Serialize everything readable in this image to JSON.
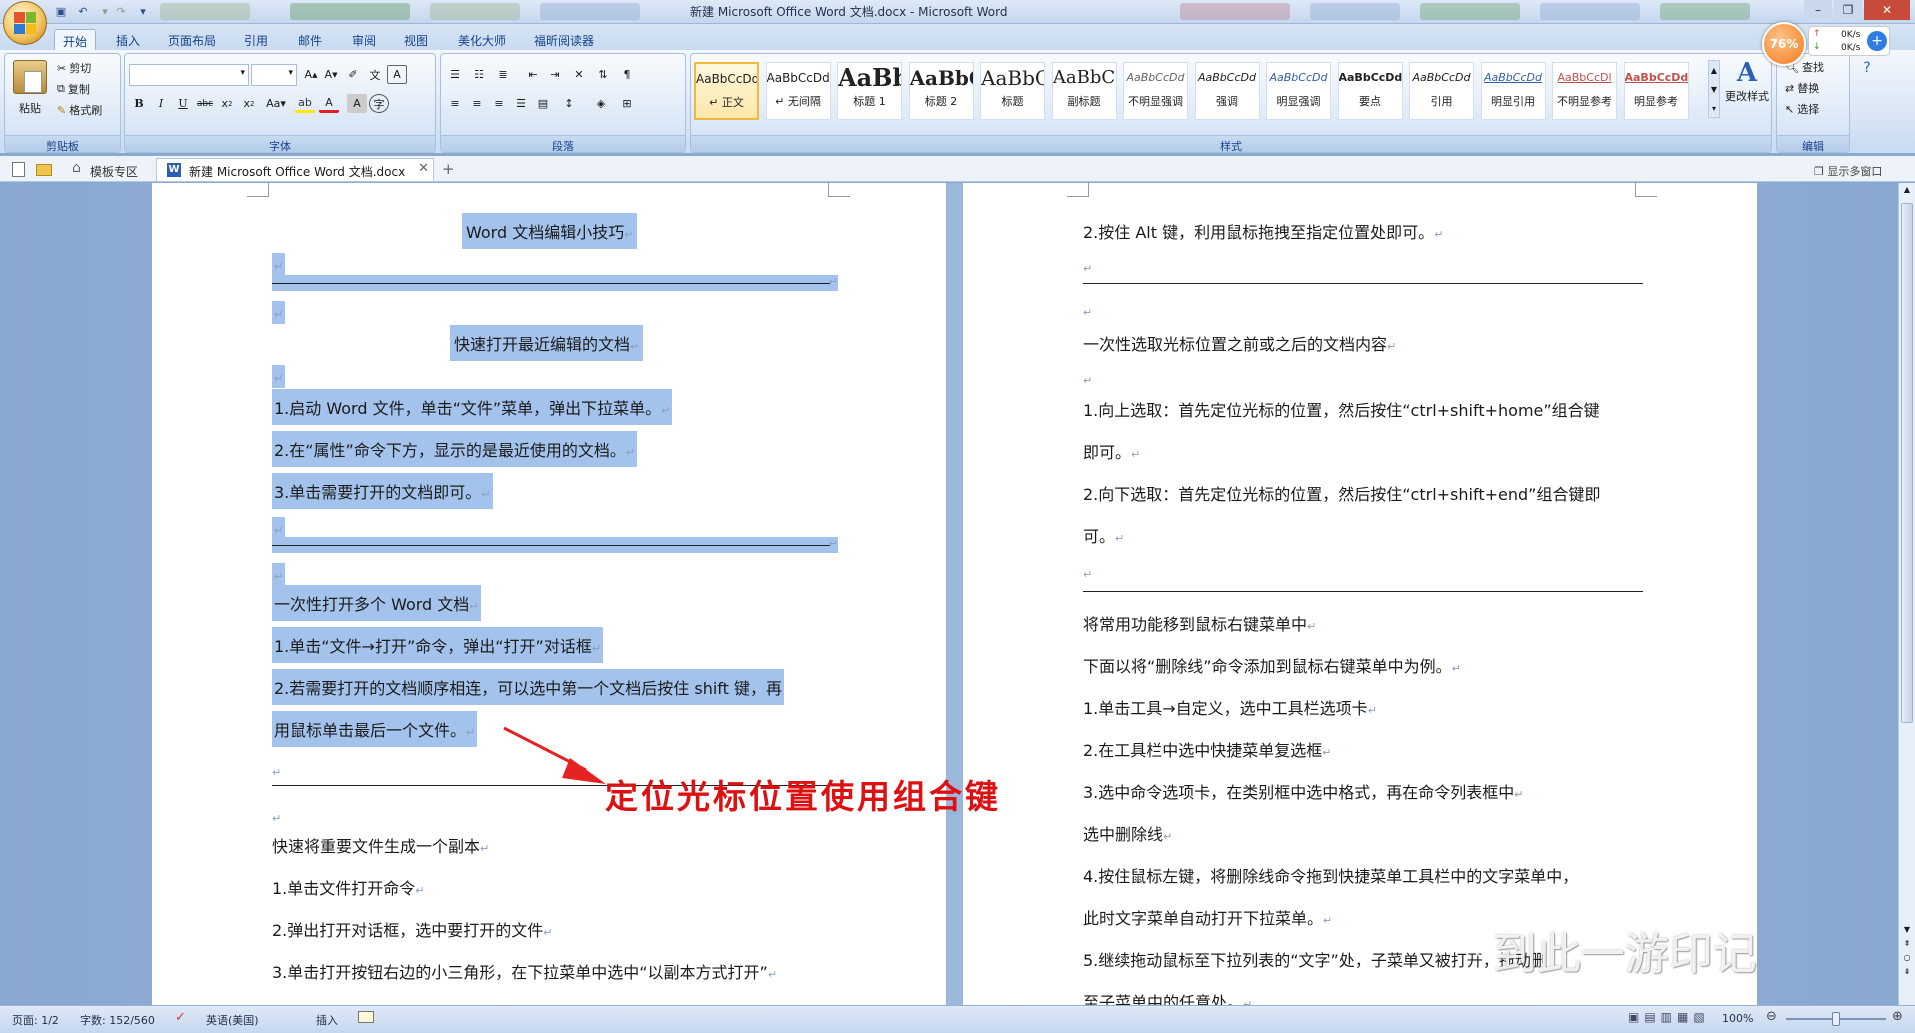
{
  "window": {
    "title": "新建 Microsoft Office Word 文档.docx - Microsoft Word"
  },
  "net_monitor": {
    "percent": "76%",
    "up": "0K/s",
    "down": "0K/s"
  },
  "tabs": [
    "开始",
    "插入",
    "页面布局",
    "引用",
    "邮件",
    "审阅",
    "视图",
    "美化大师",
    "福昕阅读器"
  ],
  "ribbon": {
    "clipboard": {
      "paste": "粘贴",
      "cut": "剪切",
      "copy": "复制",
      "format_painter": "格式刷",
      "label": "剪贴板"
    },
    "font": {
      "label": "字体",
      "font_name": "",
      "font_size": ""
    },
    "paragraph": {
      "label": "段落"
    },
    "styles": {
      "label": "样式",
      "items": [
        {
          "preview": "AaBbCcDd",
          "name": "↵ 正文"
        },
        {
          "preview": "AaBbCcDd",
          "name": "↵ 无间隔"
        },
        {
          "preview": "AaBb",
          "name": "标题 1"
        },
        {
          "preview": "AaBbC",
          "name": "标题 2"
        },
        {
          "preview": "AaBbC",
          "name": "标题"
        },
        {
          "preview": "AaBbC",
          "name": "副标题"
        },
        {
          "preview": "AaBbCcDd",
          "name": "不明显强调"
        },
        {
          "preview": "AaBbCcDd",
          "name": "强调"
        },
        {
          "preview": "AaBbCcDd",
          "name": "明显强调"
        },
        {
          "preview": "AaBbCcDd",
          "name": "要点"
        },
        {
          "preview": "AaBbCcDd",
          "name": "引用"
        },
        {
          "preview": "AaBbCcDd",
          "name": "明显引用"
        },
        {
          "preview": "AaBbCcDl",
          "name": "不明显参考"
        },
        {
          "preview": "AaBbCcDd",
          "name": "明显参考"
        }
      ],
      "change_styles": "更改样式"
    },
    "editing": {
      "label": "编辑",
      "find": "查找",
      "replace": "替换",
      "select": "选择"
    }
  },
  "docbar": {
    "template_zone": "模板专区",
    "doc_tab": "新建 Microsoft Office Word 文档.docx",
    "show_multi": "显示多窗口"
  },
  "page_left": {
    "lines": [
      "Word 文档编辑小技巧",
      "快速打开最近编辑的文档",
      "1.启动 Word 文件，单击“文件”菜单，弹出下拉菜单。",
      "2.在“属性”命令下方，显示的是最近使用的文档。",
      "3.单击需要打开的文档即可。",
      " 一次性打开多个 Word 文档",
      "1.单击“文件→打开”命令，弹出“打开”对话框",
      "2.若需要打开的文档顺序相连，可以选中第一个文档后按住 shift 键，再",
      "用鼠标单击最后一个文件。",
      "快速将重要文件生成一个副本",
      "1.单击文件打开命令",
      "2.弹出打开对话框，选中要打开的文件",
      "3.单击打开按钮右边的小三角形，在下拉菜单中选中“以副本方式打开”"
    ]
  },
  "page_right": {
    "lines": [
      "2.按住 Alt 键，利用鼠标拖拽至指定位置处即可。",
      "一次性选取光标位置之前或之后的文档内容",
      "1.向上选取：首先定位光标的位置，然后按住“ctrl+shift+home”组合键",
      "即可。",
      "2.向下选取：首先定位光标的位置，然后按住“ctrl+shift+end”组合键即",
      "可。",
      "将常用功能移到鼠标右键菜单中",
      "下面以将“删除线”命令添加到鼠标右键菜单中为例。",
      "1.单击工具→自定义，选中工具栏选项卡",
      "2.在工具栏中选中快捷菜单复选框",
      "3.选中命令选项卡，在类别框中选中格式，再在命令列表框中",
      "选中删除线",
      "4.按住鼠标左键，将删除线命令拖到快捷菜单工具栏中的文字菜单中，",
      "此时文字菜单自动打开下拉菜单。",
      "5.继续拖动鼠标至下拉列表的“文字”处，子菜单又被打开，拖动删",
      "至子菜单中的任意处。"
    ]
  },
  "annotation": "定位光标位置使用组合键",
  "watermark": "到此一游印记",
  "status": {
    "page": "页面: 1/2",
    "words": "字数: 152/560",
    "language": "英语(美国)",
    "insert": "插入",
    "zoom": "100%"
  },
  "colors": {
    "selection": "#a3c3ec",
    "annotation": "#dd1111",
    "ribbon_text": "#15428b"
  }
}
